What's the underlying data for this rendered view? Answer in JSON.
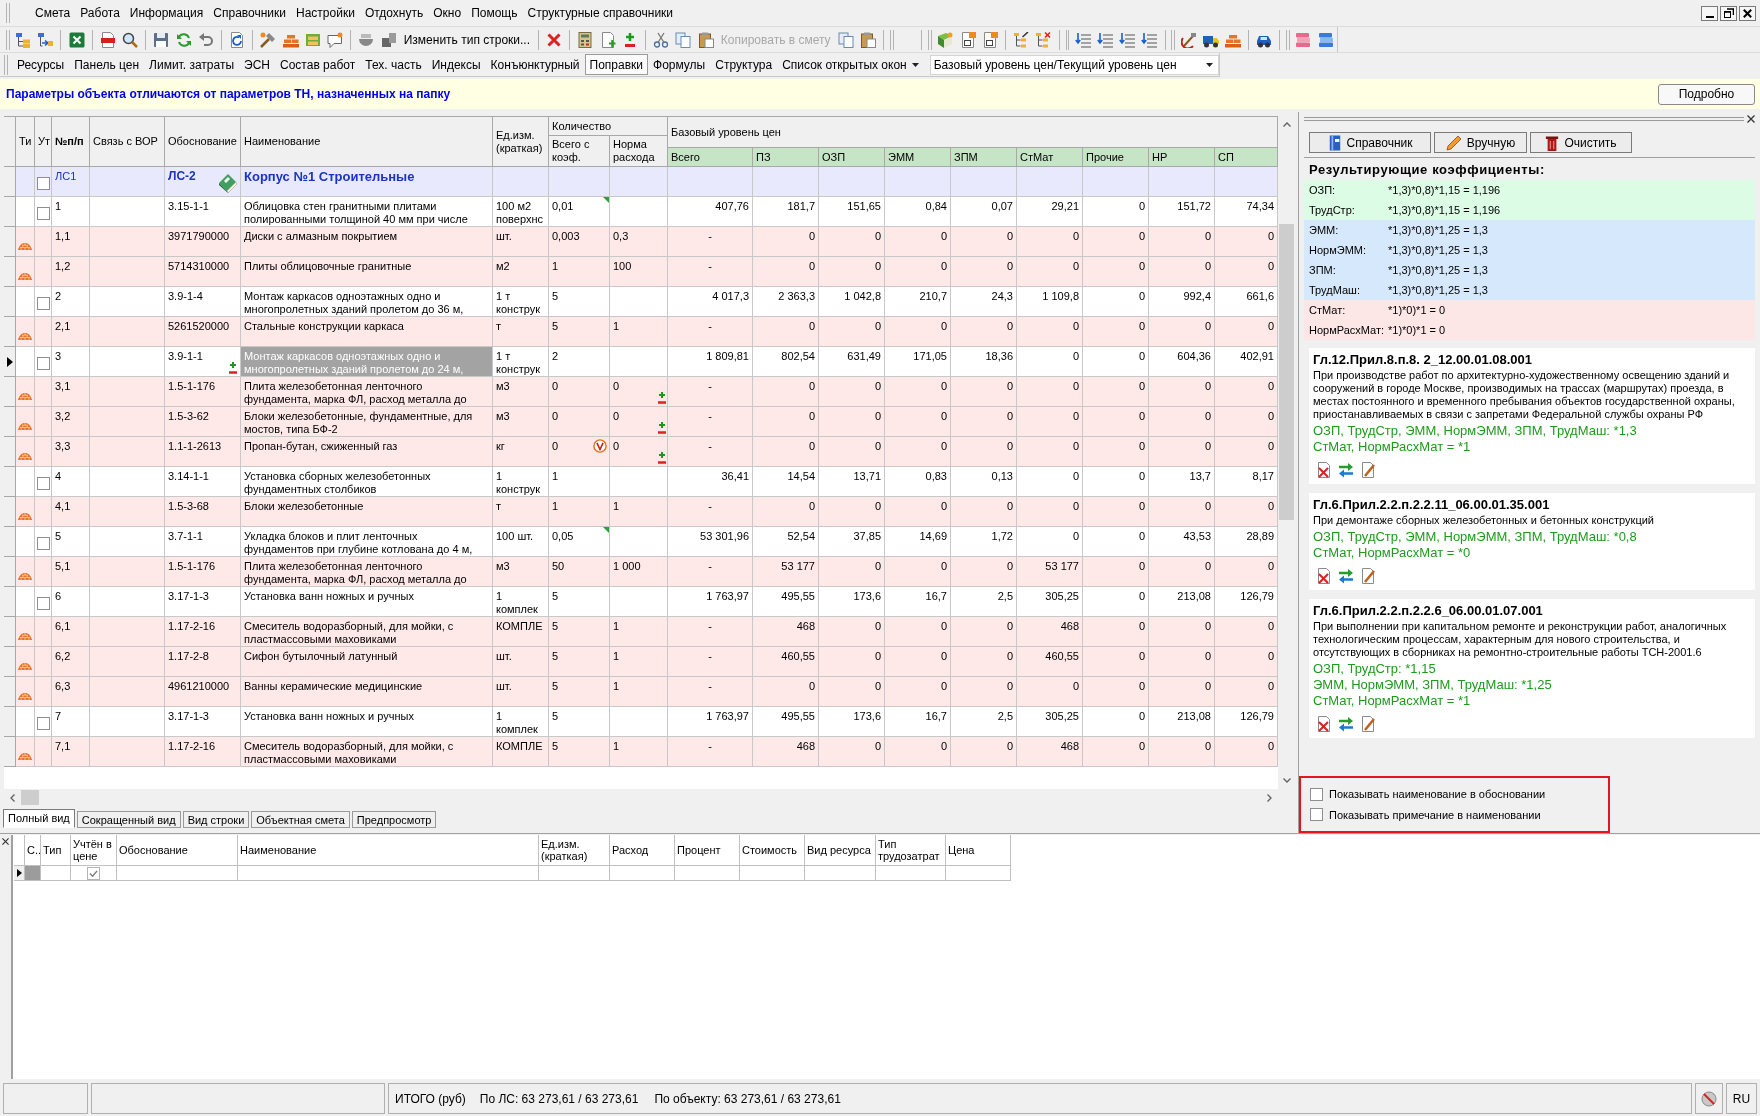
{
  "menu": [
    {
      "label": "Смета"
    },
    {
      "label": "Работа"
    },
    {
      "label": "Информация"
    },
    {
      "label": "Справочники"
    },
    {
      "label": "Настройки"
    },
    {
      "label": "Отдохнуть"
    },
    {
      "label": "Окно"
    },
    {
      "label": "Помощь"
    },
    {
      "label": "Структурные справочники"
    }
  ],
  "toolbar": {
    "change_row_type": {
      "label": "Изменить тип строки...",
      "disabled": false
    },
    "copy_to_estimate": {
      "label": "Копировать в смету",
      "disabled": true
    }
  },
  "panel_tabs": [
    {
      "label": "Ресурсы",
      "selected": false
    },
    {
      "label": "Панель цен",
      "selected": false
    },
    {
      "label": "Лимит. затраты",
      "selected": false
    },
    {
      "label": "ЭСН",
      "selected": false
    },
    {
      "label": "Состав работ",
      "selected": false
    },
    {
      "label": "Тех. часть",
      "selected": false
    },
    {
      "label": "Индексы",
      "selected": false
    },
    {
      "label": "Конъюнктурный",
      "selected": false
    },
    {
      "label": "Поправки",
      "selected": true
    },
    {
      "label": "Формулы",
      "selected": false
    },
    {
      "label": "Структура",
      "selected": false
    }
  ],
  "open_windows": {
    "label": "Список открытых окон"
  },
  "price_level": {
    "value": "Базовый уровень цен/Текущий уровень цен"
  },
  "info_bar": {
    "message": "Параметры объекта отличаются от параметров ТН, назначенных на папку",
    "button": "Подробно"
  },
  "table": {
    "columns": [
      {
        "label": "Ти"
      },
      {
        "label": "Ут"
      },
      {
        "label": "№п/п"
      },
      {
        "label": "Связь с ВОР"
      },
      {
        "label": "Обоснование"
      },
      {
        "label": "Наименование"
      },
      {
        "label": "Ед.изм. (краткая)"
      }
    ],
    "quantity_group": {
      "label": "Количество",
      "columns": [
        "Всего с коэф.",
        "Норма расхода"
      ]
    },
    "price_group": {
      "label": "Базовый уровень цен",
      "columns": [
        "Всего",
        "ПЗ",
        "ОЗП",
        "ЭММ",
        "ЗПМ",
        "СтМат",
        "Прочие",
        "НР",
        "СП"
      ]
    },
    "rows": [
      {
        "kind": "section",
        "num": "ЛС1",
        "basis": "ЛС-2",
        "name": "Корпус №1 Строительные",
        "checkbox": {
          "checked": false
        },
        "selected": false,
        "qty_flag": false,
        "qty_warning": false,
        "basis_adjusted": false,
        "norm_adjusted": false
      },
      {
        "kind": "work",
        "num": "1",
        "basis": "3.15-1-1",
        "name": "Облицовка стен гранитными плитами полированными толщиной 40 мм при числе",
        "unit": "100 м2 поверхнс",
        "qty": "0,01",
        "values": [
          "407,76",
          "181,7",
          "151,65",
          "0,84",
          "0,07",
          "29,21",
          "0",
          "151,72",
          "74,34"
        ],
        "checkbox": {
          "checked": false
        },
        "selected": false,
        "qty_flag": true,
        "qty_warning": false,
        "basis_adjusted": false,
        "norm_adjusted": false
      },
      {
        "kind": "resource",
        "num": "1,1",
        "basis": "3971790000",
        "name": "Диски с алмазным покрытием",
        "unit": "шт.",
        "qty": "0,003",
        "norm": "0,3",
        "values": [
          "-",
          "0",
          "0",
          "0",
          "0",
          "0",
          "0",
          "0",
          "0"
        ],
        "selected": false,
        "qty_flag": false,
        "qty_warning": false,
        "basis_adjusted": false,
        "norm_adjusted": false
      },
      {
        "kind": "resource",
        "num": "1,2",
        "basis": "5714310000",
        "name": "Плиты облицовочные гранитные",
        "unit": "м2",
        "qty": "1",
        "norm": "100",
        "values": [
          "-",
          "0",
          "0",
          "0",
          "0",
          "0",
          "0",
          "0",
          "0"
        ],
        "selected": false,
        "qty_flag": false,
        "qty_warning": false,
        "basis_adjusted": false,
        "norm_adjusted": false
      },
      {
        "kind": "work",
        "num": "2",
        "basis": "3.9-1-4",
        "name": "Монтаж каркасов одноэтажных одно и многопролетных зданий пролетом до 36 м,",
        "unit": "1 т конструк",
        "qty": "5",
        "values": [
          "4 017,3",
          "2 363,3",
          "1 042,8",
          "210,7",
          "24,3",
          "1 109,8",
          "0",
          "992,4",
          "661,6"
        ],
        "checkbox": {
          "checked": false
        },
        "selected": false,
        "qty_flag": false,
        "qty_warning": false,
        "basis_adjusted": false,
        "norm_adjusted": false
      },
      {
        "kind": "resource",
        "num": "2,1",
        "basis": "5261520000",
        "name": "Стальные конструкции каркаса",
        "unit": "т",
        "qty": "5",
        "norm": "1",
        "values": [
          "-",
          "0",
          "0",
          "0",
          "0",
          "0",
          "0",
          "0",
          "0"
        ],
        "selected": false,
        "qty_flag": false,
        "qty_warning": false,
        "basis_adjusted": false,
        "norm_adjusted": false
      },
      {
        "kind": "work",
        "num": "3",
        "basis": "3.9-1-1",
        "name": "Монтаж каркасов одноэтажных одно и многопролетных зданий пролетом до 24 м,",
        "unit": "1 т конструк",
        "qty": "2",
        "values": [
          "1 809,81",
          "802,54",
          "631,49",
          "171,05",
          "18,36",
          "0",
          "0",
          "604,36",
          "402,91"
        ],
        "checkbox": {
          "checked": false
        },
        "selected": true,
        "qty_flag": false,
        "qty_warning": false,
        "basis_adjusted": true,
        "norm_adjusted": false
      },
      {
        "kind": "resource",
        "num": "3,1",
        "basis": "1.5-1-176",
        "name": "Плита железобетонная ленточного фундамента, марка ФЛ, расход металла до",
        "unit": "м3",
        "qty": "0",
        "norm": "0",
        "values": [
          "-",
          "0",
          "0",
          "0",
          "0",
          "0",
          "0",
          "0",
          "0"
        ],
        "selected": false,
        "qty_flag": false,
        "qty_warning": false,
        "basis_adjusted": false,
        "norm_adjusted": true
      },
      {
        "kind": "resource",
        "num": "3,2",
        "basis": "1.5-3-62",
        "name": "Блоки железобетонные, фундаментные, для мостов, типа БФ-2",
        "unit": "м3",
        "qty": "0",
        "norm": "0",
        "values": [
          "-",
          "0",
          "0",
          "0",
          "0",
          "0",
          "0",
          "0",
          "0"
        ],
        "selected": false,
        "qty_flag": false,
        "qty_warning": false,
        "basis_adjusted": false,
        "norm_adjusted": true
      },
      {
        "kind": "resource",
        "num": "3,3",
        "basis": "1.1-1-2613",
        "name": "Пропан-бутан, сжиженный газ",
        "unit": "кг",
        "qty": "0",
        "norm": "0",
        "values": [
          "-",
          "0",
          "0",
          "0",
          "0",
          "0",
          "0",
          "0",
          "0"
        ],
        "selected": false,
        "qty_flag": false,
        "qty_warning": true,
        "basis_adjusted": false,
        "norm_adjusted": true
      },
      {
        "kind": "work",
        "num": "4",
        "basis": "3.14-1-1",
        "name": "Установка сборных железобетонных фундаментных столбиков",
        "unit": "1 конструк",
        "qty": "1",
        "values": [
          "36,41",
          "14,54",
          "13,71",
          "0,83",
          "0,13",
          "0",
          "0",
          "13,7",
          "8,17"
        ],
        "checkbox": {
          "checked": false
        },
        "selected": false,
        "qty_flag": false,
        "qty_warning": false,
        "basis_adjusted": false,
        "norm_adjusted": false
      },
      {
        "kind": "resource",
        "num": "4,1",
        "basis": "1.5-3-68",
        "name": "Блоки железобетонные",
        "unit": "т",
        "qty": "1",
        "norm": "1",
        "values": [
          "-",
          "0",
          "0",
          "0",
          "0",
          "0",
          "0",
          "0",
          "0"
        ],
        "selected": false,
        "qty_flag": false,
        "qty_warning": false,
        "basis_adjusted": false,
        "norm_adjusted": false
      },
      {
        "kind": "work",
        "num": "5",
        "basis": "3.7-1-1",
        "name": "Укладка блоков и плит ленточных фундаментов при глубине котлована до 4 м,",
        "unit": "100 шт.",
        "qty": "0,05",
        "values": [
          "53 301,96",
          "52,54",
          "37,85",
          "14,69",
          "1,72",
          "0",
          "0",
          "43,53",
          "28,89"
        ],
        "checkbox": {
          "checked": false
        },
        "selected": false,
        "qty_flag": true,
        "qty_warning": false,
        "basis_adjusted": false,
        "norm_adjusted": false
      },
      {
        "kind": "resource",
        "num": "5,1",
        "basis": "1.5-1-176",
        "name": "Плита железобетонная ленточного фундамента, марка ФЛ, расход металла до",
        "unit": "м3",
        "qty": "50",
        "norm": "1 000",
        "values": [
          "-",
          "53 177",
          "0",
          "0",
          "0",
          "53 177",
          "0",
          "0",
          "0"
        ],
        "selected": false,
        "qty_flag": false,
        "qty_warning": false,
        "basis_adjusted": false,
        "norm_adjusted": false
      },
      {
        "kind": "work",
        "num": "6",
        "basis": "3.17-1-3",
        "name": "Установка ванн ножных и ручных",
        "unit": "1 комплек",
        "qty": "5",
        "values": [
          "1 763,97",
          "495,55",
          "173,6",
          "16,7",
          "2,5",
          "305,25",
          "0",
          "213,08",
          "126,79"
        ],
        "checkbox": {
          "checked": false
        },
        "selected": false,
        "qty_flag": false,
        "qty_warning": false,
        "basis_adjusted": false,
        "norm_adjusted": false
      },
      {
        "kind": "resource",
        "num": "6,1",
        "basis": "1.17-2-16",
        "name": "Смеситель водоразборный, для мойки, с пластмассовыми маховиками",
        "unit": "КОМПЛЕ",
        "qty": "5",
        "norm": "1",
        "values": [
          "-",
          "468",
          "0",
          "0",
          "0",
          "468",
          "0",
          "0",
          "0"
        ],
        "selected": false,
        "qty_flag": false,
        "qty_warning": false,
        "basis_adjusted": false,
        "norm_adjusted": false
      },
      {
        "kind": "resource",
        "num": "6,2",
        "basis": "1.17-2-8",
        "name": "Сифон бутылочный латунный",
        "unit": "шт.",
        "qty": "5",
        "norm": "1",
        "values": [
          "-",
          "460,55",
          "0",
          "0",
          "0",
          "460,55",
          "0",
          "0",
          "0"
        ],
        "selected": false,
        "qty_flag": false,
        "qty_warning": false,
        "basis_adjusted": false,
        "norm_adjusted": false
      },
      {
        "kind": "resource",
        "num": "6,3",
        "basis": "4961210000",
        "name": "Ванны керамические медицинские",
        "unit": "шт.",
        "qty": "5",
        "norm": "1",
        "values": [
          "-",
          "0",
          "0",
          "0",
          "0",
          "0",
          "0",
          "0",
          "0"
        ],
        "selected": false,
        "qty_flag": false,
        "qty_warning": false,
        "basis_adjusted": false,
        "norm_adjusted": false
      },
      {
        "kind": "work",
        "num": "7",
        "basis": "3.17-1-3",
        "name": "Установка ванн ножных и ручных",
        "unit": "1 комплек",
        "qty": "5",
        "values": [
          "1 763,97",
          "495,55",
          "173,6",
          "16,7",
          "2,5",
          "305,25",
          "0",
          "213,08",
          "126,79"
        ],
        "checkbox": {
          "checked": false
        },
        "selected": false,
        "qty_flag": false,
        "qty_warning": false,
        "basis_adjusted": false,
        "norm_adjusted": false
      },
      {
        "kind": "resource",
        "num": "7,1",
        "basis": "1.17-2-16",
        "name": "Смеситель водоразборный, для мойки, с пластмассовыми маховиками",
        "unit": "КОМПЛЕ",
        "qty": "5",
        "norm": "1",
        "values": [
          "-",
          "468",
          "0",
          "0",
          "0",
          "468",
          "0",
          "0",
          "0"
        ],
        "selected": false,
        "qty_flag": false,
        "qty_warning": false,
        "basis_adjusted": false,
        "norm_adjusted": false
      }
    ]
  },
  "corrections_panel": {
    "buttons": [
      {
        "kind": "catalog",
        "label": "Справочник"
      },
      {
        "kind": "manual",
        "label": "Вручную"
      },
      {
        "kind": "clear",
        "label": "Очистить"
      }
    ],
    "title": "Результирующие коэффициенты:",
    "coefficients": [
      {
        "label": "ОЗП:",
        "value": "*1,3)*0,8)*1,15 = 1,196",
        "color": "#dcfce6"
      },
      {
        "label": "ТрудСтр:",
        "value": "*1,3)*0,8)*1,15 = 1,196",
        "color": "#dcfce6"
      },
      {
        "label": "ЭММ:",
        "value": "*1,3)*0,8)*1,25 = 1,3",
        "color": "#d6e8fb"
      },
      {
        "label": "НормЭММ:",
        "value": "*1,3)*0,8)*1,25 = 1,3",
        "color": "#d6e8fb"
      },
      {
        "label": "ЗПМ:",
        "value": "*1,3)*0,8)*1,25 = 1,3",
        "color": "#d6e8fb"
      },
      {
        "label": "ТрудМаш:",
        "value": "*1,3)*0,8)*1,25 = 1,3",
        "color": "#d6e8fb"
      },
      {
        "label": "СтМат:",
        "value": "*1)*0)*1 = 0",
        "color": "#fde6e6"
      },
      {
        "label": "НормРасхМат:",
        "value": "*1)*0)*1 = 0",
        "color": "#fde6e6"
      }
    ],
    "corrections": [
      {
        "title": "Гл.12.Прил.8.п.8. 2_12.00.01.08.001",
        "description": "При производстве работ по архитектурно-художественному освещению зданий и сооружений в городе Москве, производимых на трассах (маршрутах) проезда, в местах постоянного и временного пребывания объектов государственной охраны, приостанавливаемых в связи с запретами Федеральной службы охраны РФ",
        "effects": [
          "ОЗП, ТрудСтр, ЭММ, НормЭММ, ЗПМ, ТрудМаш: *1,3",
          "СтМат, НормРасхМат = *1"
        ]
      },
      {
        "title": "Гл.6.Прил.2.2.п.2.2.11_06.00.01.35.001",
        "description": "При демонтаже сборных железобетонных и бетонных конструкций",
        "effects": [
          "ОЗП, ТрудСтр, ЭММ, НормЭММ, ЗПМ, ТрудМаш: *0,8",
          "СтМат, НормРасхМат = *0"
        ]
      },
      {
        "title": "Гл.6.Прил.2.2.п.2.2.6_06.00.01.07.001",
        "description": "При выполнении при капитальном ремонте и реконструкции работ, аналогичных технологическим процессам, характерным для нового строительства, и отсутствующих в сборниках на ремонтно-строительные работы ТСН-2001.6",
        "effects": [
          "ОЗП, ТрудСтр: *1,15",
          "ЭММ, НормЭММ, ЗПМ, ТрудМаш: *1,25",
          "СтМат, НормРасхМат = *1"
        ]
      }
    ],
    "options": {
      "highlighted": true,
      "items": [
        {
          "label": "Показывать наименование в обосновании",
          "checked": false
        },
        {
          "label": "Показывать примечание в наименовании",
          "checked": false
        }
      ]
    }
  },
  "view_tabs": [
    {
      "label": "Полный вид",
      "selected": true
    },
    {
      "label": "Сокращенный вид",
      "selected": false
    },
    {
      "label": "Вид строки",
      "selected": false
    },
    {
      "label": "Объектная смета",
      "selected": false
    },
    {
      "label": "Предпросмотр",
      "selected": false
    }
  ],
  "resource_grid": {
    "columns": [
      "С..",
      "Тип",
      "Учтён в цене",
      "Обоснование",
      "Наименование",
      "Ед.изм. (краткая)",
      "Расход",
      "Процент",
      "Стоимость",
      "Вид ресурса",
      "Тип трудозатрат",
      "Цена"
    ],
    "rows": [
      {
        "selected": true,
        "included": true
      }
    ]
  },
  "status_bar": {
    "total_label": "ИТОГО (руб)",
    "by_estimate": "По ЛС: 63 273,61 / 63 273,61",
    "by_object": "По объекту: 63 273,61 / 63 273,61",
    "language": "RU"
  }
}
